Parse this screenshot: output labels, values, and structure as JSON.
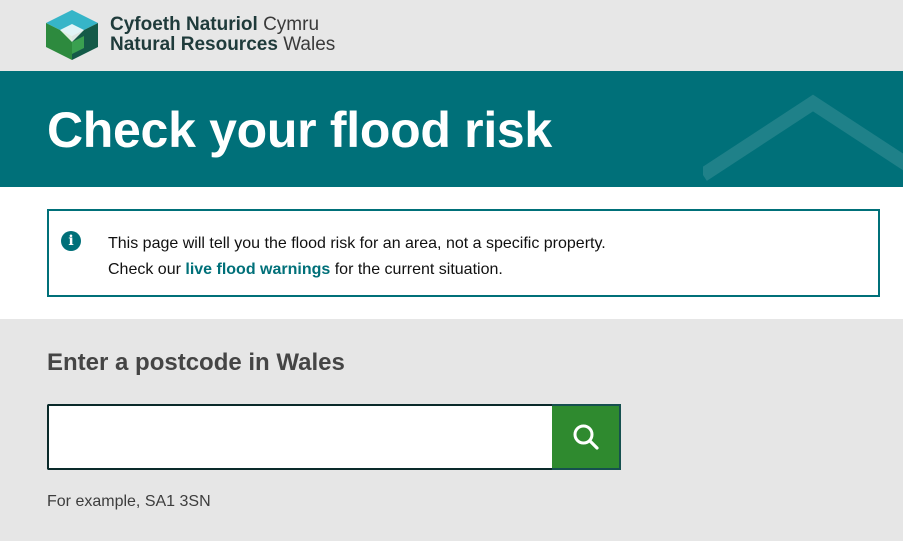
{
  "header": {
    "logo_line1_bold": "Cyfoeth Naturiol",
    "logo_line1_regular": "Cymru",
    "logo_line2_bold": "Natural Resources",
    "logo_line2_regular": "Wales"
  },
  "hero": {
    "title": "Check your flood risk"
  },
  "notice": {
    "icon": "info-icon",
    "line1": "This page will tell you the flood risk for an area, not a specific property.",
    "line2_prefix": "Check our",
    "link_text": "live flood warnings",
    "line2_suffix": "for the current situation."
  },
  "search": {
    "label": "Enter a postcode in Wales",
    "input_value": "",
    "button_icon": "search-icon",
    "hint": "For example, SA1 3SN"
  },
  "colors": {
    "brand_teal": "#007079",
    "search_button_green": "#2f8a2f",
    "page_background": "#e6e6e6"
  }
}
